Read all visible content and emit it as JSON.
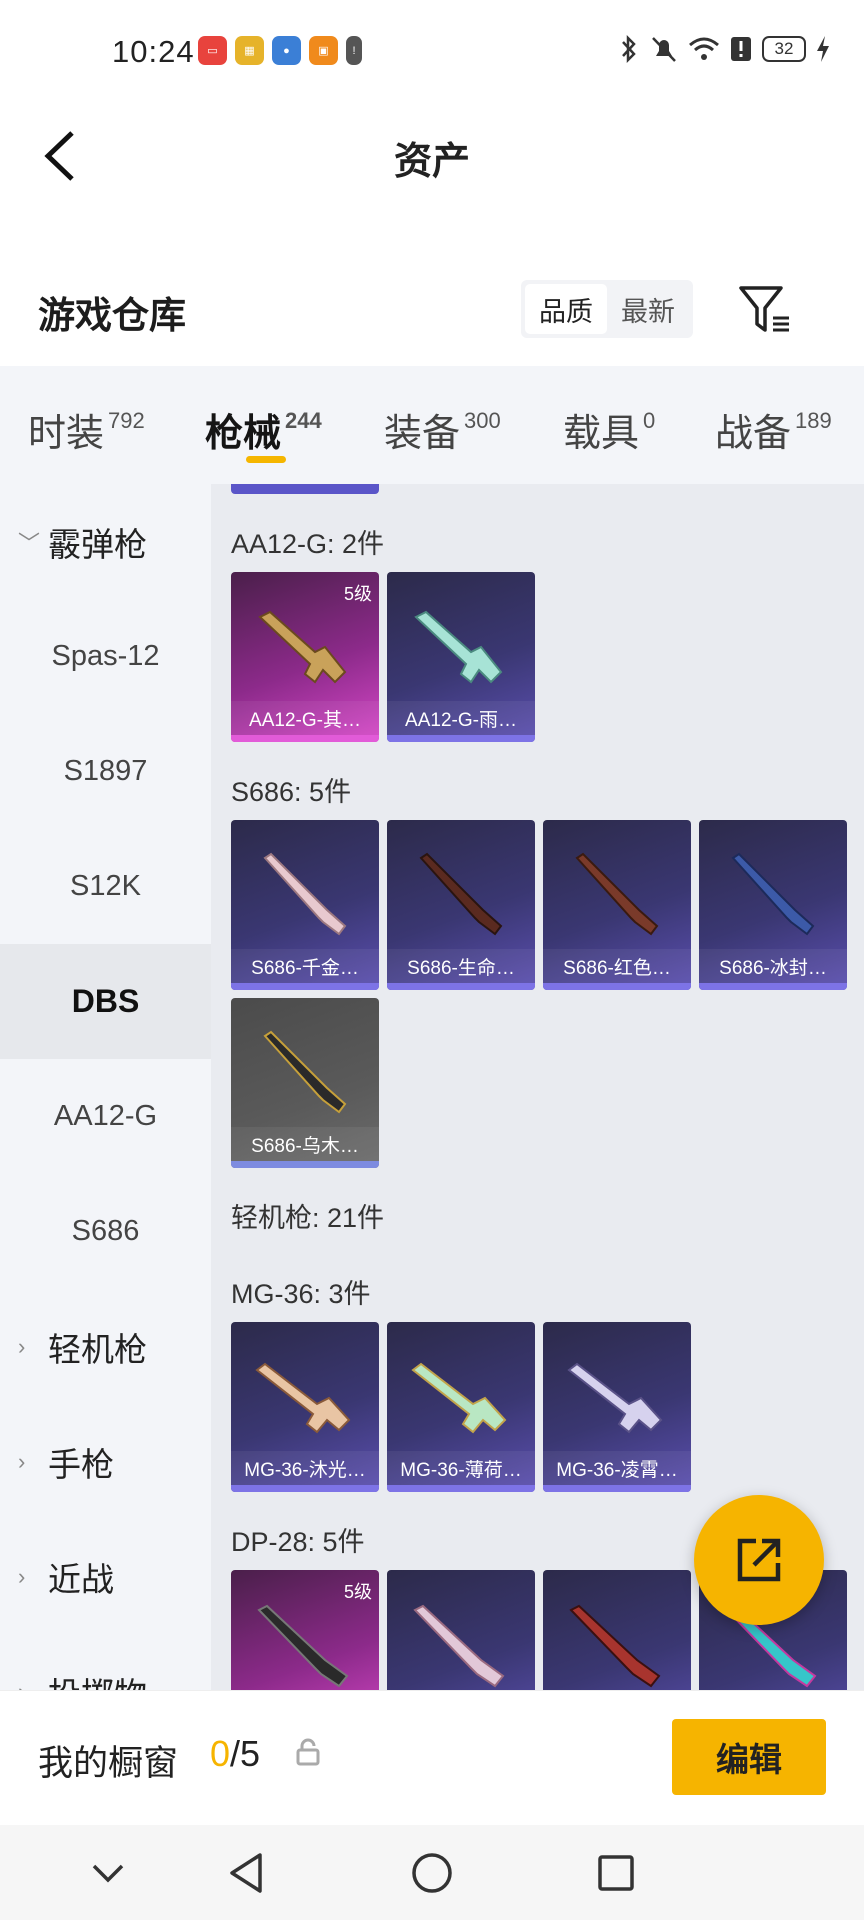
{
  "status_bar": {
    "time": "10:24",
    "battery": "32"
  },
  "header": {
    "title": "资产"
  },
  "warehouse": {
    "title": "游戏仓库",
    "sort_options": [
      "品质",
      "最新"
    ],
    "active_sort": "品质"
  },
  "tabs": [
    {
      "label": "时装",
      "count": "792"
    },
    {
      "label": "枪械",
      "count": "244",
      "active": true
    },
    {
      "label": "装备",
      "count": "300"
    },
    {
      "label": "载具",
      "count": "0"
    },
    {
      "label": "战备",
      "count": "189"
    }
  ],
  "sidebar": {
    "groups": [
      {
        "label": "霰弹枪",
        "expanded": true
      },
      {
        "label": "轻机枪"
      },
      {
        "label": "手枪"
      },
      {
        "label": "近战"
      },
      {
        "label": "投掷物"
      }
    ],
    "items": [
      "Spas-12",
      "S1897",
      "S12K",
      "DBS",
      "AA12-G",
      "S686"
    ],
    "active_item": "DBS"
  },
  "content": {
    "groups": [
      {
        "label": "AA12-G: 2件",
        "cards": [
          {
            "name": "AA12-G-其…",
            "level": "5级",
            "style": "gold"
          },
          {
            "name": "AA12-G-雨…",
            "style": "purple"
          }
        ]
      },
      {
        "label": "S686: 5件",
        "cards": [
          {
            "name": "S686-千金…",
            "style": "purple"
          },
          {
            "name": "S686-生命…",
            "style": "purple"
          },
          {
            "name": "S686-红色…",
            "style": "purple"
          },
          {
            "name": "S686-冰封…",
            "style": "purple"
          },
          {
            "name": "S686-乌木…",
            "style": "grey"
          }
        ]
      },
      {
        "label": "轻机枪: 21件"
      },
      {
        "label": "MG-36: 3件",
        "cards": [
          {
            "name": "MG-36-沐光…",
            "style": "purple"
          },
          {
            "name": "MG-36-薄荷…",
            "style": "purple"
          },
          {
            "name": "MG-36-凌霄…",
            "style": "purple"
          }
        ]
      },
      {
        "label": "DP-28: 5件",
        "cards": [
          {
            "name": "",
            "level": "5级",
            "style": "gold"
          },
          {
            "name": "",
            "style": "purple"
          },
          {
            "name": "",
            "style": "purple"
          },
          {
            "name": "",
            "style": "purple"
          }
        ]
      }
    ]
  },
  "bottom_bar": {
    "showcase_label": "我的橱窗",
    "showcase_current": "0",
    "showcase_total": "/5",
    "edit_label": "编辑"
  },
  "colors": {
    "accent": "#f6b400",
    "card_purple": "#3a3772",
    "card_gold": "#8c2a8a"
  }
}
